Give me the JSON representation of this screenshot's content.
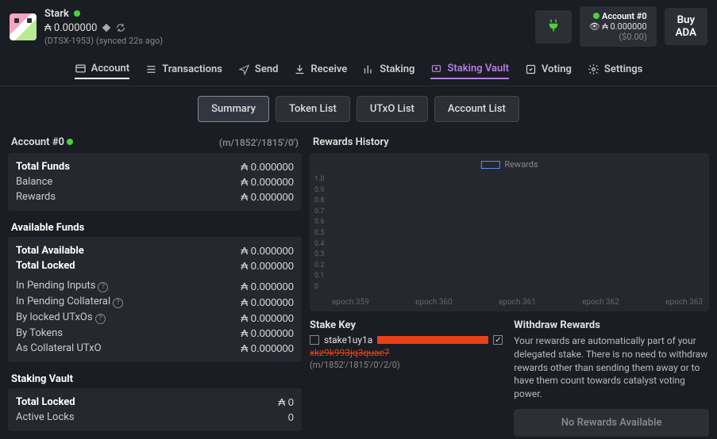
{
  "header": {
    "wallet_name": "Stark",
    "status": "online",
    "balance": "₳ 0.000000",
    "sync_text": "(DTSX-1953) (synced 22s ago)"
  },
  "account_summary": {
    "label": "Account #0",
    "balance": "₳ 0.000000",
    "fiat": "($0.00)"
  },
  "buy_button": "Buy\nADA",
  "nav": {
    "account": "Account",
    "transactions": "Transactions",
    "send": "Send",
    "receive": "Receive",
    "staking": "Staking",
    "staking_vault": "Staking Vault",
    "voting": "Voting",
    "settings": "Settings"
  },
  "subnav": {
    "summary": "Summary",
    "token_list": "Token List",
    "utxo_list": "UTxO List",
    "account_list": "Account List"
  },
  "account_panel": {
    "title": "Account #0",
    "path": "(m/1852'/1815'/0')",
    "total_funds": {
      "label": "Total Funds",
      "value": "₳ 0.000000"
    },
    "balance": {
      "label": "Balance",
      "value": "₳ 0.000000"
    },
    "rewards": {
      "label": "Rewards",
      "value": "₳ 0.000000"
    }
  },
  "available_funds": {
    "title": "Available Funds",
    "total_available": {
      "label": "Total Available",
      "value": "₳ 0.000000"
    },
    "total_locked": {
      "label": "Total Locked",
      "value": "₳ 0.000000"
    },
    "rows": [
      {
        "label": "In Pending Inputs",
        "value": "₳ 0.000000",
        "info": true
      },
      {
        "label": "In Pending Collateral",
        "value": "₳ 0.000000",
        "info": true
      },
      {
        "label": "By locked UTxOs",
        "value": "₳ 0.000000",
        "info": true
      },
      {
        "label": "By Tokens",
        "value": "₳ 0.000000"
      },
      {
        "label": "As Collateral UTxO",
        "value": "₳ 0.000000"
      }
    ]
  },
  "staking_vault": {
    "title": "Staking Vault",
    "total_locked": {
      "label": "Total Locked",
      "value": "₳ 0"
    },
    "active_locks": {
      "label": "Active Locks",
      "value": "0"
    }
  },
  "rewards_history": {
    "title": "Rewards History",
    "legend": "Rewards"
  },
  "chart_data": {
    "type": "bar",
    "categories": [
      "epoch 359",
      "epoch 360",
      "epoch 361",
      "epoch 362",
      "epoch 363"
    ],
    "series": [
      {
        "name": "Rewards",
        "values": [
          0,
          0,
          0,
          0,
          0
        ]
      }
    ],
    "ylim": [
      0,
      1.0
    ],
    "yticks": [
      "1.0",
      "0.9",
      "0.8",
      "0.7",
      "0.6",
      "0.5",
      "0.4",
      "0.3",
      "0.2",
      "0.1",
      "0"
    ],
    "xlabel": "",
    "ylabel": ""
  },
  "stake_key": {
    "title": "Stake Key",
    "prefix": "stake1uy1a",
    "redacted_suffix": "xkz9k993jq3quac7",
    "path": "(m/1852'/1815'/0'/2/0)"
  },
  "withdraw": {
    "title": "Withdraw Rewards",
    "desc": "Your rewards are automatically part of your delegated stake. There is no need to withdraw rewards other than sending them away or to have them count towards catalyst voting power.",
    "button": "No Rewards Available"
  }
}
